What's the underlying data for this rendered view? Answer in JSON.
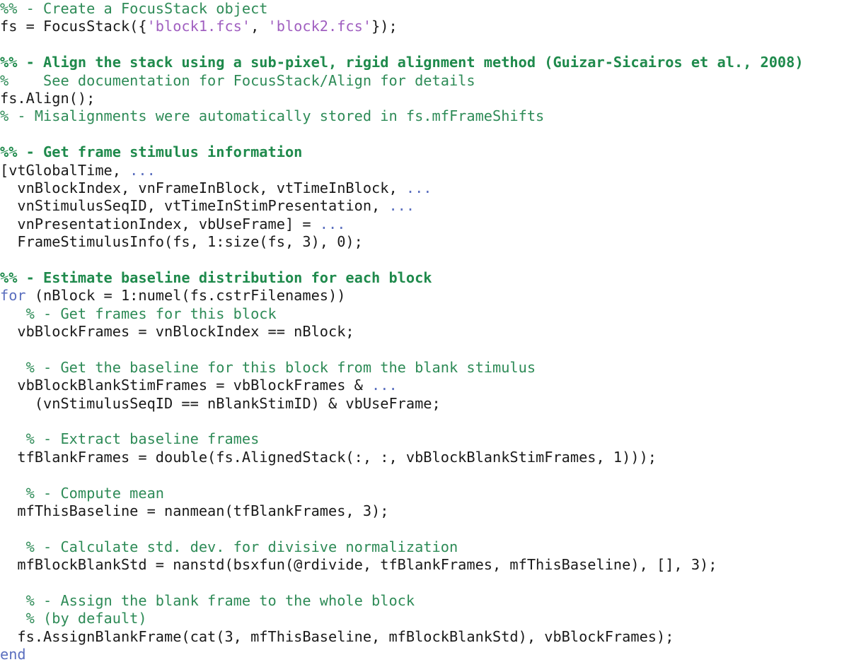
{
  "document": {
    "kind": "matlab-code-listing",
    "language": "MATLAB",
    "background_color": "#ffffff",
    "colors": {
      "plain": "#1a1a1a",
      "comment": "#2E8B57",
      "section_comment": "#1F8A4C",
      "string": "#A05FC0",
      "keyword": "#5B6FBF",
      "continuation": "#5B6FBF"
    }
  },
  "lines": [
    {
      "id": 1,
      "tokens": [
        {
          "t": "%% - Create a FocusStack object",
          "c": "comment"
        }
      ]
    },
    {
      "id": 2,
      "tokens": [
        {
          "t": "fs = FocusStack({",
          "c": "plain"
        },
        {
          "t": "'block1.fcs'",
          "c": "string"
        },
        {
          "t": ", ",
          "c": "plain"
        },
        {
          "t": "'block2.fcs'",
          "c": "string"
        },
        {
          "t": "});",
          "c": "plain"
        }
      ]
    },
    {
      "id": 3,
      "tokens": [
        {
          "t": "",
          "c": "plain"
        }
      ]
    },
    {
      "id": 4,
      "tokens": [
        {
          "t": "%% - Align the stack using a sub-pixel, rigid alignment method (Guizar-Sicairos et al., 2008)",
          "c": "section"
        }
      ]
    },
    {
      "id": 5,
      "tokens": [
        {
          "t": "%    See documentation for FocusStack/Align for details",
          "c": "comment"
        }
      ]
    },
    {
      "id": 6,
      "tokens": [
        {
          "t": "fs.Align();",
          "c": "plain"
        }
      ]
    },
    {
      "id": 7,
      "tokens": [
        {
          "t": "% - Misalignments were automatically stored in fs.mfFrameShifts",
          "c": "comment"
        }
      ]
    },
    {
      "id": 8,
      "tokens": [
        {
          "t": "",
          "c": "plain"
        }
      ]
    },
    {
      "id": 9,
      "tokens": [
        {
          "t": "%% - Get frame stimulus information",
          "c": "section"
        }
      ]
    },
    {
      "id": 10,
      "tokens": [
        {
          "t": "[vtGlobalTime, ",
          "c": "plain"
        },
        {
          "t": "...",
          "c": "cont"
        }
      ]
    },
    {
      "id": 11,
      "tokens": [
        {
          "t": "  vnBlockIndex, vnFrameInBlock, vtTimeInBlock, ",
          "c": "plain"
        },
        {
          "t": "...",
          "c": "cont"
        }
      ]
    },
    {
      "id": 12,
      "tokens": [
        {
          "t": "  vnStimulusSeqID, vtTimeInStimPresentation, ",
          "c": "plain"
        },
        {
          "t": "...",
          "c": "cont"
        }
      ]
    },
    {
      "id": 13,
      "tokens": [
        {
          "t": "  vnPresentationIndex, vbUseFrame] = ",
          "c": "plain"
        },
        {
          "t": "...",
          "c": "cont"
        }
      ]
    },
    {
      "id": 14,
      "tokens": [
        {
          "t": "  FrameStimulusInfo(fs, 1:size(fs, 3), 0);",
          "c": "plain"
        }
      ]
    },
    {
      "id": 15,
      "tokens": [
        {
          "t": "",
          "c": "plain"
        }
      ]
    },
    {
      "id": 16,
      "tokens": [
        {
          "t": "%% - Estimate baseline distribution for each block",
          "c": "section"
        }
      ]
    },
    {
      "id": 17,
      "tokens": [
        {
          "t": "for",
          "c": "keyword"
        },
        {
          "t": " (nBlock = 1:numel(fs.cstrFilenames))",
          "c": "plain"
        }
      ]
    },
    {
      "id": 18,
      "tokens": [
        {
          "t": "   % - Get frames for this block",
          "c": "comment"
        }
      ]
    },
    {
      "id": 19,
      "tokens": [
        {
          "t": "  vbBlockFrames = vnBlockIndex == nBlock;",
          "c": "plain"
        }
      ]
    },
    {
      "id": 20,
      "tokens": [
        {
          "t": "",
          "c": "plain"
        }
      ]
    },
    {
      "id": 21,
      "tokens": [
        {
          "t": "   % - Get the baseline for this block from the blank stimulus",
          "c": "comment"
        }
      ]
    },
    {
      "id": 22,
      "tokens": [
        {
          "t": "  vbBlockBlankStimFrames = vbBlockFrames & ",
          "c": "plain"
        },
        {
          "t": "...",
          "c": "cont"
        }
      ]
    },
    {
      "id": 23,
      "tokens": [
        {
          "t": "    (vnStimulusSeqID == nBlankStimID) & vbUseFrame;",
          "c": "plain"
        }
      ]
    },
    {
      "id": 24,
      "tokens": [
        {
          "t": "",
          "c": "plain"
        }
      ]
    },
    {
      "id": 25,
      "tokens": [
        {
          "t": "   % - Extract baseline frames",
          "c": "comment"
        }
      ]
    },
    {
      "id": 26,
      "tokens": [
        {
          "t": "  tfBlankFrames = double(fs.AlignedStack(:, :, vbBlockBlankStimFrames, 1)));",
          "c": "plain"
        }
      ]
    },
    {
      "id": 27,
      "tokens": [
        {
          "t": "",
          "c": "plain"
        }
      ]
    },
    {
      "id": 28,
      "tokens": [
        {
          "t": "   % - Compute mean",
          "c": "comment"
        }
      ]
    },
    {
      "id": 29,
      "tokens": [
        {
          "t": "  mfThisBaseline = nanmean(tfBlankFrames, 3);",
          "c": "plain"
        }
      ]
    },
    {
      "id": 30,
      "tokens": [
        {
          "t": "",
          "c": "plain"
        }
      ]
    },
    {
      "id": 31,
      "tokens": [
        {
          "t": "   % - Calculate std. dev. for divisive normalization",
          "c": "comment"
        }
      ]
    },
    {
      "id": 32,
      "tokens": [
        {
          "t": "  mfBlockBlankStd = nanstd(bsxfun(@rdivide, tfBlankFrames, mfThisBaseline), [], 3);",
          "c": "plain"
        }
      ]
    },
    {
      "id": 33,
      "tokens": [
        {
          "t": "",
          "c": "plain"
        }
      ]
    },
    {
      "id": 34,
      "tokens": [
        {
          "t": "   % - Assign the blank frame to the whole block",
          "c": "comment"
        }
      ]
    },
    {
      "id": 35,
      "tokens": [
        {
          "t": "   % (by default)",
          "c": "comment"
        }
      ]
    },
    {
      "id": 36,
      "tokens": [
        {
          "t": "  fs.AssignBlankFrame(cat(3, mfThisBaseline, mfBlockBlankStd), vbBlockFrames);",
          "c": "plain"
        }
      ]
    },
    {
      "id": 37,
      "tokens": [
        {
          "t": "end",
          "c": "keyword"
        }
      ]
    }
  ]
}
